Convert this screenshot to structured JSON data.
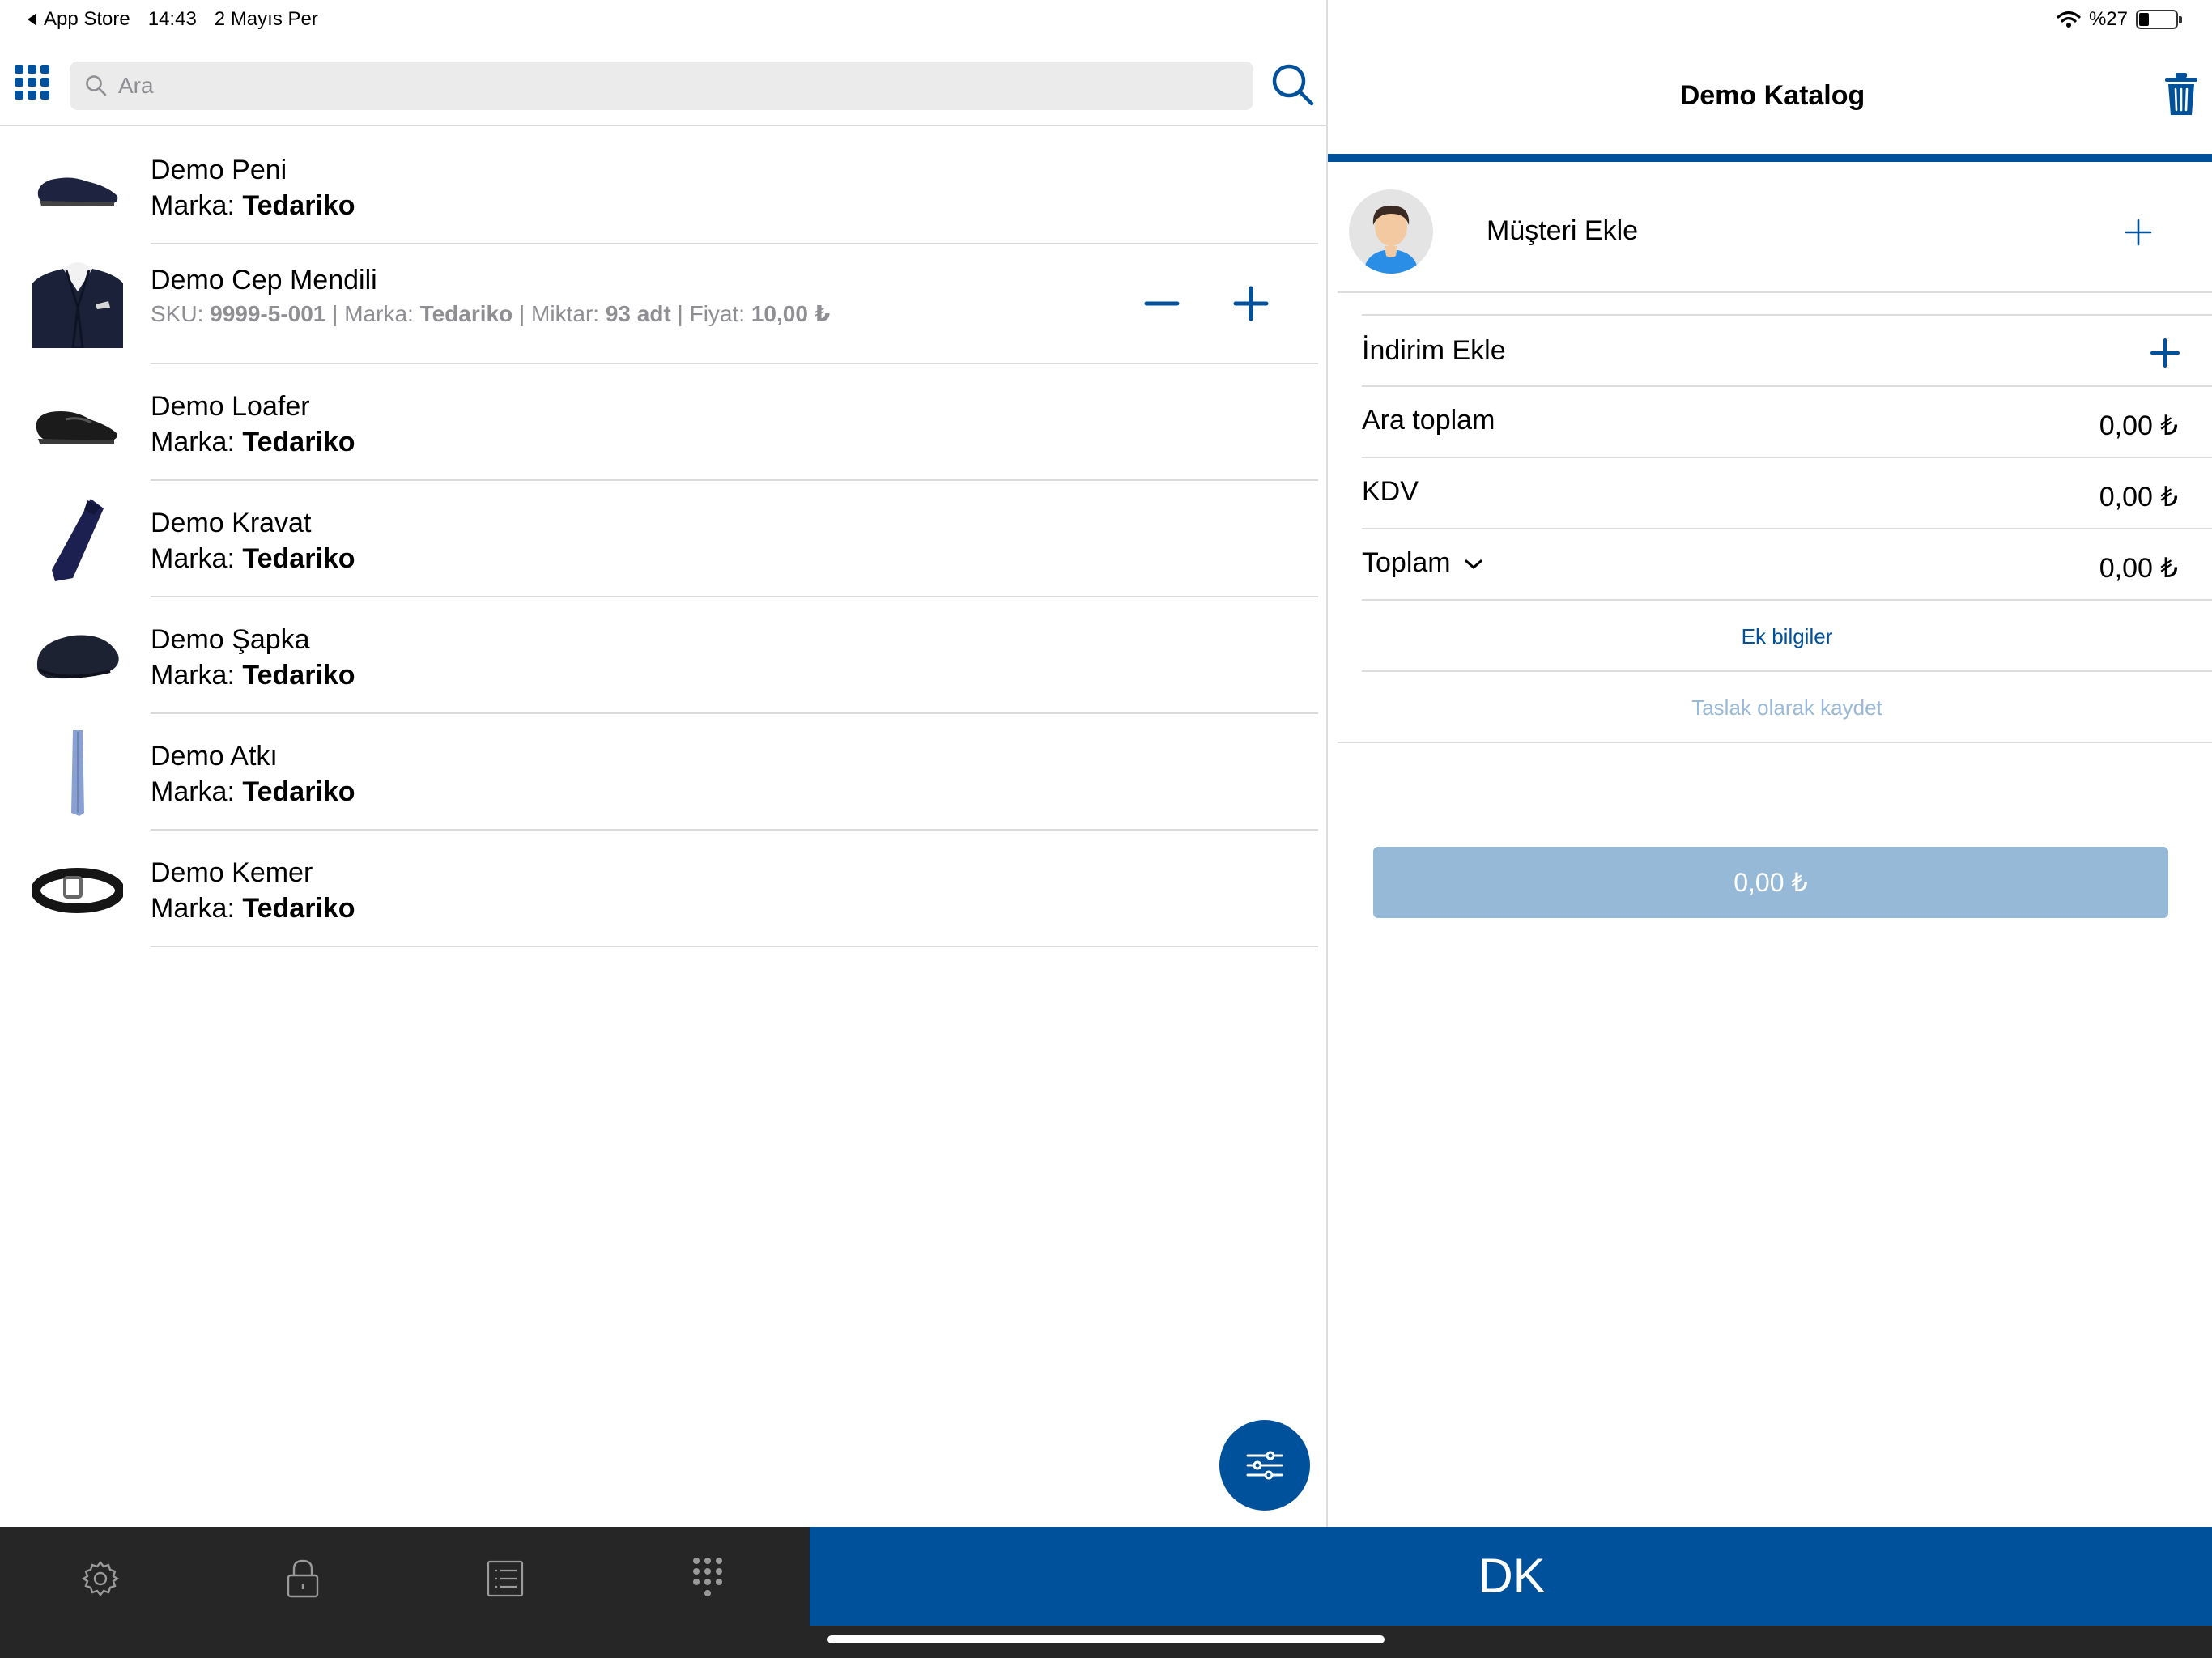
{
  "status_bar": {
    "back_app": "App Store",
    "time": "14:43",
    "date": "2 Mayıs Per",
    "battery_text": "%27",
    "battery_level_percent": 27
  },
  "colors": {
    "accent": "#00519b",
    "pay_button_disabled": "#97b9d8",
    "tab_bar": "#262626",
    "divider": "#dcdcdc"
  },
  "search": {
    "placeholder": "Ara"
  },
  "products": [
    {
      "name": "Demo Peni",
      "brand_label": "Marka:",
      "brand": "Tedariko",
      "icon": "loafer-shoe-thumbnail"
    },
    {
      "name": "Demo Cep Mendili",
      "icon": "suit-pocket-square-thumbnail",
      "sku_label": "SKU:",
      "sku": "9999-5-001",
      "sep": "|",
      "brand_label": "Marka:",
      "brand": "Tedariko",
      "qty_label": "Miktar:",
      "qty": "93 adt",
      "price_label": "Fiyat:",
      "price": "10,00 ₺"
    },
    {
      "name": "Demo Loafer",
      "brand_label": "Marka:",
      "brand": "Tedariko",
      "icon": "loafer-thumbnail"
    },
    {
      "name": "Demo Kravat",
      "brand_label": "Marka:",
      "brand": "Tedariko",
      "icon": "tie-thumbnail"
    },
    {
      "name": "Demo Şapka",
      "brand_label": "Marka:",
      "brand": "Tedariko",
      "icon": "flat-cap-thumbnail"
    },
    {
      "name": "Demo Atkı",
      "brand_label": "Marka:",
      "brand": "Tedariko",
      "icon": "scarf-thumbnail"
    },
    {
      "name": "Demo Kemer",
      "brand_label": "Marka:",
      "brand": "Tedariko",
      "icon": "belt-thumbnail"
    }
  ],
  "cart": {
    "title": "Demo Katalog",
    "customer_add_label": "Müşteri Ekle",
    "discount_add_label": "İndirim Ekle",
    "subtotal_label": "Ara toplam",
    "subtotal_value": "0,00 ₺",
    "vat_label": "KDV",
    "vat_value": "0,00 ₺",
    "total_label": "Toplam",
    "total_value": "0,00 ₺",
    "extra_info_link": "Ek bilgiler",
    "save_draft_link": "Taslak olarak kaydet",
    "pay_button_label": "0,00 ₺"
  },
  "tab_bar": {
    "items": [
      "gear-icon",
      "lock-icon",
      "list-icon",
      "keypad-icon"
    ],
    "dk_label": "DK"
  }
}
